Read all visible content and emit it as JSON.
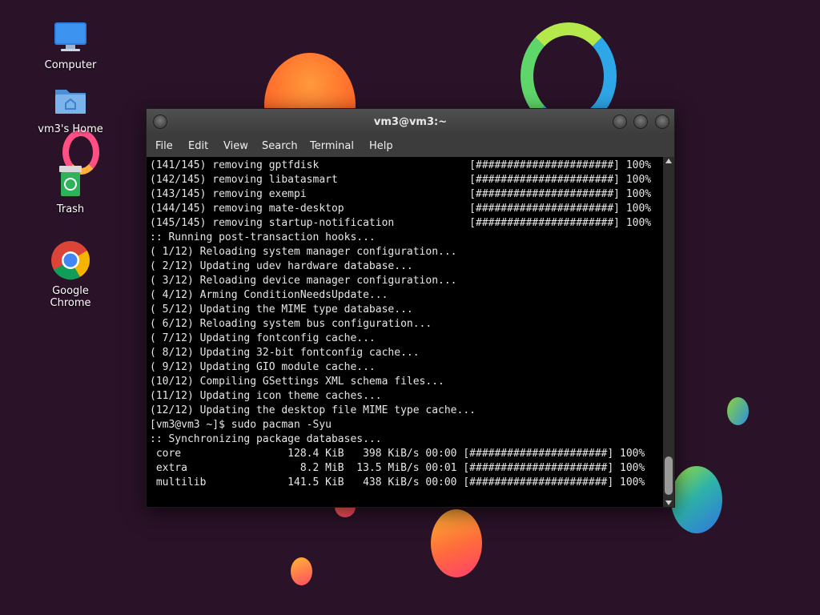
{
  "colors": {
    "wallpaper": "#2a1228",
    "terminal_bg": "#000000",
    "terminal_fg": "#e6e6e6",
    "titlebar": "#3b3b3b"
  },
  "desktop": {
    "icons": [
      {
        "label": "Computer",
        "icon": "monitor-icon"
      },
      {
        "label": "vm3's Home",
        "icon": "home-folder-icon"
      },
      {
        "label": "Trash",
        "icon": "trash-icon"
      },
      {
        "label": "Google Chrome",
        "icon": "chrome-icon"
      }
    ]
  },
  "window": {
    "title": "vm3@vm3:~",
    "menu": [
      "File",
      "Edit",
      "View",
      "Search",
      "Terminal",
      "Help"
    ],
    "lines": [
      "(141/145) removing gptfdisk                        [######################] 100%",
      "(142/145) removing libatasmart                     [######################] 100%",
      "(143/145) removing exempi                          [######################] 100%",
      "(144/145) removing mate-desktop                    [######################] 100%",
      "(145/145) removing startup-notification            [######################] 100%",
      ":: Running post-transaction hooks...",
      "( 1/12) Reloading system manager configuration...",
      "( 2/12) Updating udev hardware database...",
      "( 3/12) Reloading device manager configuration...",
      "( 4/12) Arming ConditionNeedsUpdate...",
      "( 5/12) Updating the MIME type database...",
      "( 6/12) Reloading system bus configuration...",
      "( 7/12) Updating fontconfig cache...",
      "( 8/12) Updating 32-bit fontconfig cache...",
      "( 9/12) Updating GIO module cache...",
      "(10/12) Compiling GSettings XML schema files...",
      "(11/12) Updating icon theme caches...",
      "(12/12) Updating the desktop file MIME type cache...",
      "[vm3@vm3 ~]$ sudo pacman -Syu",
      ":: Synchronizing package databases...",
      " core                 128.4 KiB   398 KiB/s 00:00 [######################] 100%",
      " extra                  8.2 MiB  13.5 MiB/s 00:01 [######################] 100%",
      " multilib             141.5 KiB   438 KiB/s 00:00 [######################] 100%"
    ]
  }
}
